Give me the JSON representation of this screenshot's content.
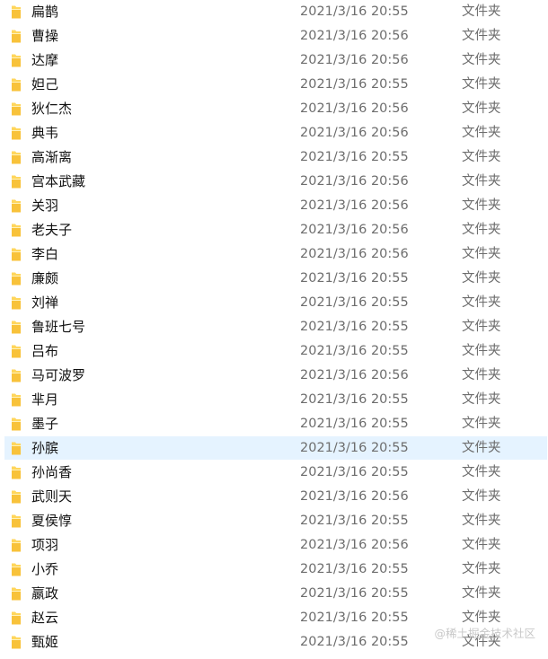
{
  "files": [
    {
      "name": "扁鹊",
      "modified": "2021/3/16 20:55",
      "type": "文件夹"
    },
    {
      "name": "曹操",
      "modified": "2021/3/16 20:56",
      "type": "文件夹"
    },
    {
      "name": "达摩",
      "modified": "2021/3/16 20:56",
      "type": "文件夹"
    },
    {
      "name": "妲己",
      "modified": "2021/3/16 20:55",
      "type": "文件夹"
    },
    {
      "name": "狄仁杰",
      "modified": "2021/3/16 20:56",
      "type": "文件夹"
    },
    {
      "name": "典韦",
      "modified": "2021/3/16 20:56",
      "type": "文件夹"
    },
    {
      "name": "高渐离",
      "modified": "2021/3/16 20:55",
      "type": "文件夹"
    },
    {
      "name": "宫本武藏",
      "modified": "2021/3/16 20:56",
      "type": "文件夹"
    },
    {
      "name": "关羽",
      "modified": "2021/3/16 20:56",
      "type": "文件夹"
    },
    {
      "name": "老夫子",
      "modified": "2021/3/16 20:56",
      "type": "文件夹"
    },
    {
      "name": "李白",
      "modified": "2021/3/16 20:56",
      "type": "文件夹"
    },
    {
      "name": "廉颇",
      "modified": "2021/3/16 20:55",
      "type": "文件夹"
    },
    {
      "name": "刘禅",
      "modified": "2021/3/16 20:55",
      "type": "文件夹"
    },
    {
      "name": "鲁班七号",
      "modified": "2021/3/16 20:55",
      "type": "文件夹"
    },
    {
      "name": "吕布",
      "modified": "2021/3/16 20:55",
      "type": "文件夹"
    },
    {
      "name": "马可波罗",
      "modified": "2021/3/16 20:56",
      "type": "文件夹"
    },
    {
      "name": "芈月",
      "modified": "2021/3/16 20:55",
      "type": "文件夹"
    },
    {
      "name": "墨子",
      "modified": "2021/3/16 20:55",
      "type": "文件夹"
    },
    {
      "name": "孙膑",
      "modified": "2021/3/16 20:55",
      "type": "文件夹"
    },
    {
      "name": "孙尚香",
      "modified": "2021/3/16 20:55",
      "type": "文件夹"
    },
    {
      "name": "武则天",
      "modified": "2021/3/16 20:56",
      "type": "文件夹"
    },
    {
      "name": "夏侯惇",
      "modified": "2021/3/16 20:55",
      "type": "文件夹"
    },
    {
      "name": "项羽",
      "modified": "2021/3/16 20:56",
      "type": "文件夹"
    },
    {
      "name": "小乔",
      "modified": "2021/3/16 20:55",
      "type": "文件夹"
    },
    {
      "name": "嬴政",
      "modified": "2021/3/16 20:55",
      "type": "文件夹"
    },
    {
      "name": "赵云",
      "modified": "2021/3/16 20:55",
      "type": "文件夹"
    },
    {
      "name": "甄姬",
      "modified": "2021/3/16 20:55",
      "type": "文件夹"
    }
  ],
  "hovered_index": 18,
  "icon": "folder-icon",
  "colors": {
    "hover_background": "#e5f3ff",
    "folder_body": "#ffd65c",
    "folder_front": "#f8c23a",
    "muted_text": "#6d6d6d"
  },
  "watermark": "@稀土掘金技术社区"
}
